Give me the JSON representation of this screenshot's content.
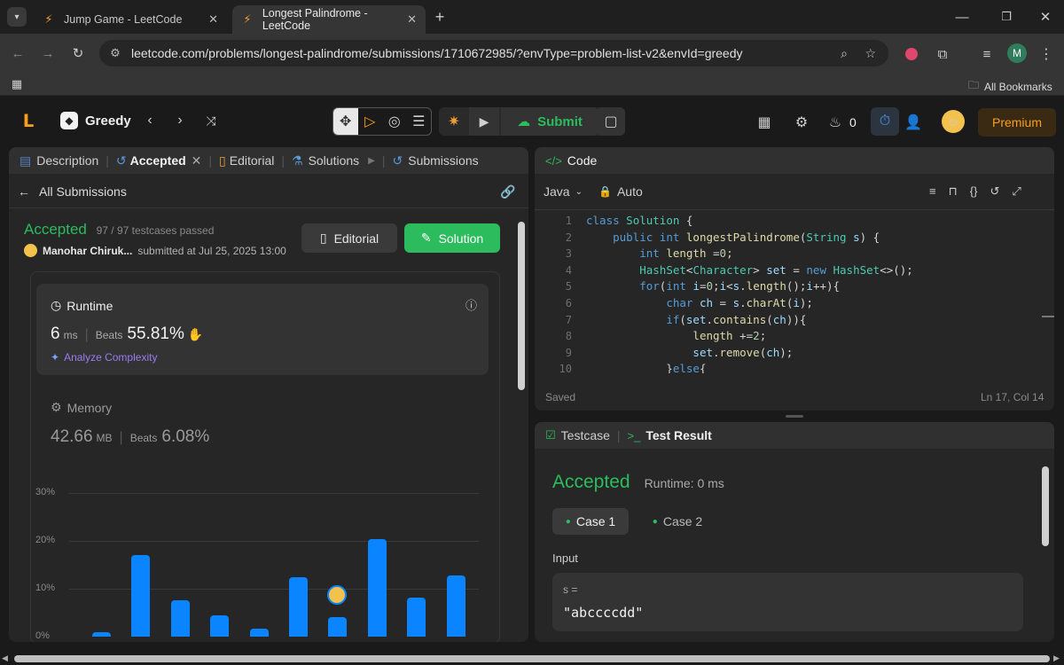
{
  "browser": {
    "tabs": [
      {
        "title": "Jump Game - LeetCode",
        "active": false
      },
      {
        "title": "Longest Palindrome - LeetCode",
        "active": true
      }
    ],
    "url": "leetcode.com/problems/longest-palindrome/submissions/1710672985/?envType=problem-list-v2&envId=greedy",
    "bookmarks_label": "All Bookmarks",
    "profile_initial": "M"
  },
  "header": {
    "list_name": "Greedy",
    "submit_label": "Submit",
    "streak_count": "0",
    "premium_label": "Premium"
  },
  "left": {
    "tabs": {
      "description": "Description",
      "accepted": "Accepted",
      "editorial": "Editorial",
      "solutions": "Solutions",
      "submissions": "Submissions"
    },
    "all_submissions": "All Submissions",
    "status": "Accepted",
    "testcases": "97 / 97 testcases passed",
    "user": "Manohar Chiruk...",
    "submitted": "submitted at Jul 25, 2025 13:00",
    "editorial_btn": "Editorial",
    "solution_btn": "Solution",
    "runtime": {
      "label": "Runtime",
      "value": "6",
      "unit": "ms",
      "beats_label": "Beats",
      "beats": "55.81%",
      "analyze": "Analyze Complexity"
    },
    "memory": {
      "label": "Memory",
      "value": "42.66",
      "unit": "MB",
      "beats_label": "Beats",
      "beats": "6.08%"
    }
  },
  "chart_data": {
    "type": "bar",
    "yticks": [
      "30%",
      "20%",
      "10%",
      "0%"
    ],
    "ylim": [
      0,
      30
    ],
    "values": [
      1,
      17,
      7.6,
      4.4,
      1.6,
      12.4,
      4,
      20.4,
      8.2,
      12.8
    ],
    "highlight_index": 6,
    "color": "#0a84ff"
  },
  "code": {
    "title": "Code",
    "language": "Java",
    "mode": "Auto",
    "lines": [
      "class Solution {",
      "    public int longestPalindrome(String s) {",
      "        int length =0;",
      "        HashSet<Character> set = new HashSet<>();",
      "        for(int i=0;i<s.length();i++){",
      "            char ch = s.charAt(i);",
      "            if(set.contains(ch)){",
      "                length +=2;",
      "                set.remove(ch);",
      "            }else{"
    ],
    "status": "Saved",
    "cursor": "Ln 17, Col 14"
  },
  "result": {
    "testcase_tab": "Testcase",
    "result_tab": "Test Result",
    "status": "Accepted",
    "runtime": "Runtime: 0 ms",
    "cases": [
      "Case 1",
      "Case 2"
    ],
    "input_label": "Input",
    "var_label": "s =",
    "var_value": "\"abccccdd\""
  }
}
